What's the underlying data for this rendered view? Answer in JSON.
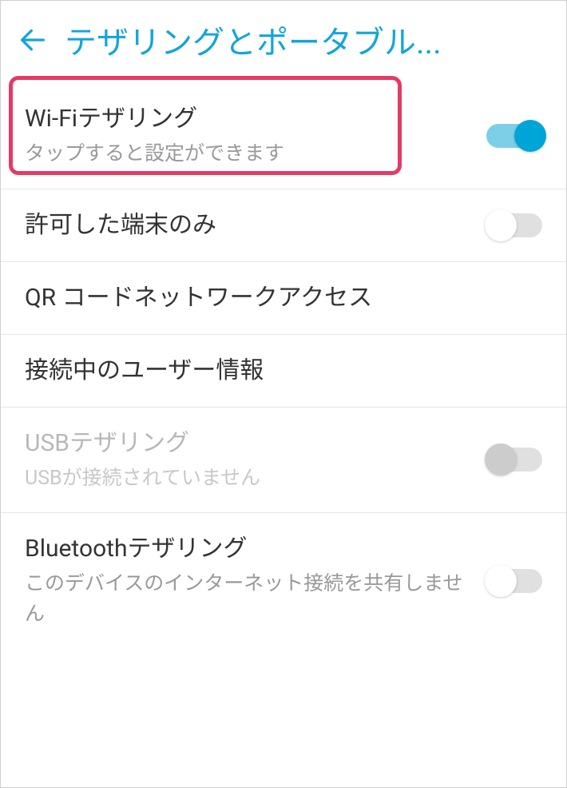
{
  "header": {
    "title": "テザリングとポータブル..."
  },
  "items": {
    "wifi_tethering": {
      "title": "Wi-Fiテザリング",
      "subtitle": "タップすると設定ができます",
      "toggle": true
    },
    "allowed_devices": {
      "title": "許可した端末のみ",
      "toggle": false
    },
    "qr_access": {
      "title": "QR コードネットワークアクセス"
    },
    "connected_users": {
      "title": "接続中のユーザー情報"
    },
    "usb_tethering": {
      "title": "USBテザリング",
      "subtitle": "USBが接続されていません",
      "toggle": false,
      "disabled": true
    },
    "bluetooth_tethering": {
      "title": "Bluetoothテザリング",
      "subtitle": "このデバイスのインターネット接続を共有しません",
      "toggle": false
    }
  },
  "colors": {
    "accent": "#14a5d8",
    "highlight": "#e63965"
  }
}
